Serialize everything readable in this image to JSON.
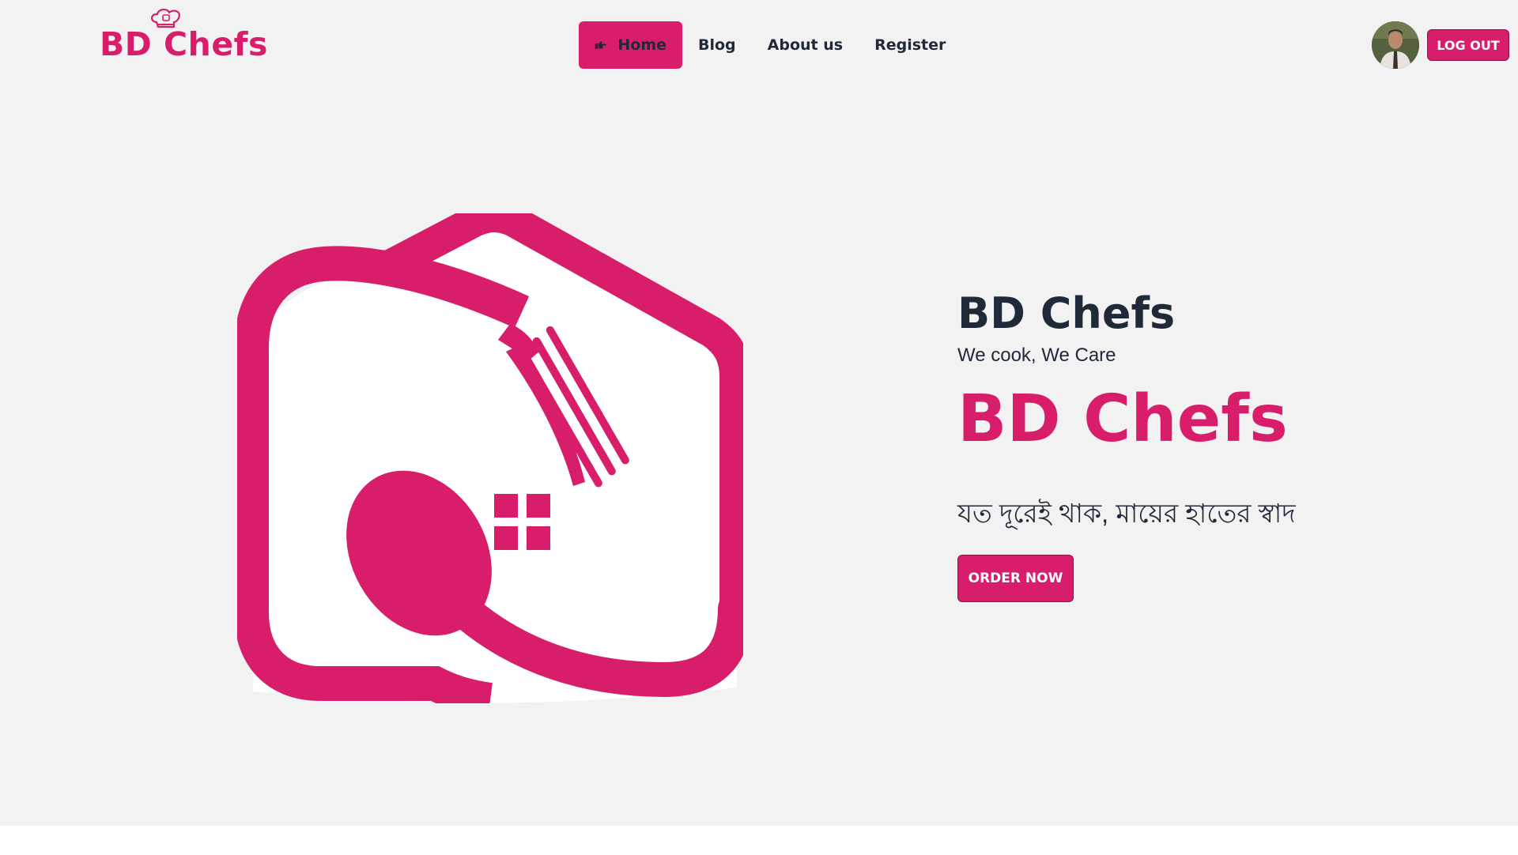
{
  "brand": {
    "name": "BD Chefs",
    "accent_color": "#d81e6a",
    "hat_icon": "chef-hat-icon"
  },
  "nav": {
    "items": [
      {
        "label": "Home",
        "active": true,
        "icon": "pointing-hand-icon"
      },
      {
        "label": "Blog",
        "active": false
      },
      {
        "label": "About us",
        "active": false
      },
      {
        "label": "Register",
        "active": false
      }
    ]
  },
  "user": {
    "avatar": "user-avatar",
    "logout_label": "LOG OUT"
  },
  "hero": {
    "logo": "house-plate-fork-spoon-logo",
    "title": "BD Chefs",
    "tagline": "We cook, We Care",
    "brand_big": "BD Chefs",
    "bengali_slogan": "যত দূরেই থাক, মায়ের হাতের স্বাদ",
    "order_label": "ORDER NOW"
  },
  "colors": {
    "background": "#f2f2f2",
    "text_dark": "#1f2937",
    "accent": "#d81e6a"
  }
}
